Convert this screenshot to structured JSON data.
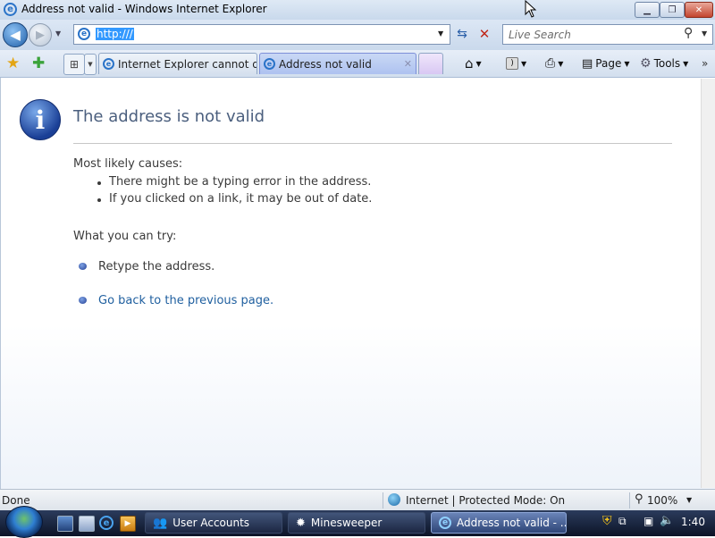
{
  "window": {
    "title": "Address not valid - Windows Internet Explorer"
  },
  "addressbar": {
    "url": "http:///"
  },
  "search": {
    "placeholder": "Live Search"
  },
  "tabs": [
    {
      "label": "Internet Explorer cannot di...",
      "active": false
    },
    {
      "label": "Address not valid",
      "active": true
    }
  ],
  "toolbar": {
    "page_label": "Page",
    "tools_label": "Tools"
  },
  "content": {
    "heading": "The address is not valid",
    "causes_title": "Most likely causes:",
    "causes": [
      "There might be a typing error in the address.",
      "If you clicked on a link, it may be out of date."
    ],
    "try_title": "What you can try:",
    "try_items": [
      "Retype the address.",
      "Go back to the previous page."
    ]
  },
  "statusbar": {
    "status": "Done",
    "zone": "Internet | Protected Mode: On",
    "zoom": "100%"
  },
  "taskbar": {
    "items": [
      {
        "label": "User Accounts",
        "icon": "users-icon"
      },
      {
        "label": "Minesweeper",
        "icon": "mine-icon"
      },
      {
        "label": "Address not valid - ...",
        "icon": "ie-icon"
      }
    ],
    "clock": "1:40"
  },
  "colors": {
    "heading": "#4b5f7e",
    "link": "#1f5f9f",
    "highlight": "#3399ff"
  }
}
